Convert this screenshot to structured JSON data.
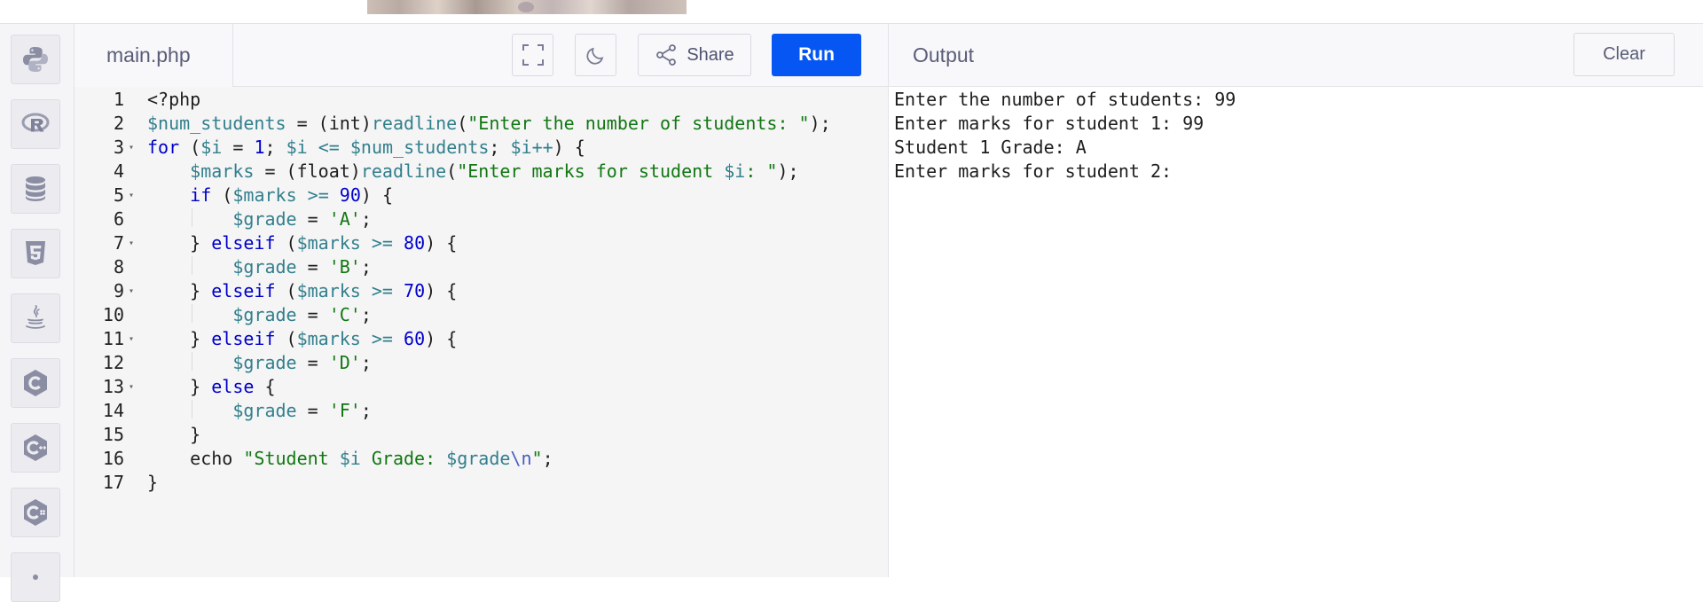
{
  "editor": {
    "filename": "main.php",
    "share_label": "Share",
    "run_label": "Run",
    "lines": [
      {
        "n": "1",
        "fold": false,
        "html": "&lt;?php"
      },
      {
        "n": "2",
        "fold": false,
        "html": "<span class=\"v\">$num_students</span> = (int)<span class=\"v\">readline</span>(<span class=\"s\">\"Enter the number of students: \"</span>);"
      },
      {
        "n": "3",
        "fold": true,
        "html": "<span class=\"k\">for</span> (<span class=\"v\">$i</span> = <span class=\"n\">1</span>; <span class=\"v\">$i</span> <span class=\"v\">&lt;=</span> <span class=\"v\">$num_students</span>; <span class=\"v\">$i++</span>) {"
      },
      {
        "n": "4",
        "fold": false,
        "html": "    <span class=\"v\">$marks</span> = (float)<span class=\"v\">readline</span>(<span class=\"s\">\"Enter marks for student <span class=\"v\">$i</span>: \"</span>);"
      },
      {
        "n": "5",
        "fold": true,
        "html": "    <span class=\"k\">if</span> (<span class=\"v\">$marks</span> <span class=\"v\">&gt;=</span> <span class=\"n\">90</span>) {"
      },
      {
        "n": "6",
        "fold": false,
        "html": "        <span class=\"v\">$grade</span> = <span class=\"s\">'A'</span>;"
      },
      {
        "n": "7",
        "fold": true,
        "html": "    } <span class=\"k\">elseif</span> (<span class=\"v\">$marks</span> <span class=\"v\">&gt;=</span> <span class=\"n\">80</span>) {"
      },
      {
        "n": "8",
        "fold": false,
        "html": "        <span class=\"v\">$grade</span> = <span class=\"s\">'B'</span>;"
      },
      {
        "n": "9",
        "fold": true,
        "html": "    } <span class=\"k\">elseif</span> (<span class=\"v\">$marks</span> <span class=\"v\">&gt;=</span> <span class=\"n\">70</span>) {"
      },
      {
        "n": "10",
        "fold": false,
        "html": "        <span class=\"v\">$grade</span> = <span class=\"s\">'C'</span>;"
      },
      {
        "n": "11",
        "fold": true,
        "html": "    } <span class=\"k\">elseif</span> (<span class=\"v\">$marks</span> <span class=\"v\">&gt;=</span> <span class=\"n\">60</span>) {"
      },
      {
        "n": "12",
        "fold": false,
        "html": "        <span class=\"v\">$grade</span> = <span class=\"s\">'D'</span>;"
      },
      {
        "n": "13",
        "fold": true,
        "html": "    } <span class=\"k\">else</span> {"
      },
      {
        "n": "14",
        "fold": false,
        "html": "        <span class=\"v\">$grade</span> = <span class=\"s\">'F'</span>;"
      },
      {
        "n": "15",
        "fold": false,
        "html": "    }"
      },
      {
        "n": "16",
        "fold": false,
        "html": "    echo <span class=\"s\">\"Student <span class=\"v\">$i</span> Grade: <span class=\"v\">$grade</span><span class=\"e\">\\n</span>\"</span>;"
      },
      {
        "n": "17",
        "fold": false,
        "html": "}"
      }
    ]
  },
  "output": {
    "title": "Output",
    "clear_label": "Clear",
    "lines": [
      "Enter the number of students: 99",
      "Enter marks for student 1: 99",
      "Student 1 Grade: A",
      "Enter marks for student 2:"
    ]
  },
  "sidebar": {
    "items": [
      {
        "icon": "python-icon"
      },
      {
        "icon": "r-language-icon"
      },
      {
        "icon": "database-icon"
      },
      {
        "icon": "html5-icon"
      },
      {
        "icon": "java-icon"
      },
      {
        "icon": "c-language-icon"
      },
      {
        "icon": "cpp-icon"
      },
      {
        "icon": "csharp-icon"
      },
      {
        "icon": "more-languages-icon"
      }
    ]
  },
  "colors": {
    "accent": "#0556f3",
    "keyword": "#0000c8",
    "variable": "#327f8c",
    "string": "#117711",
    "number": "#0000cd"
  }
}
